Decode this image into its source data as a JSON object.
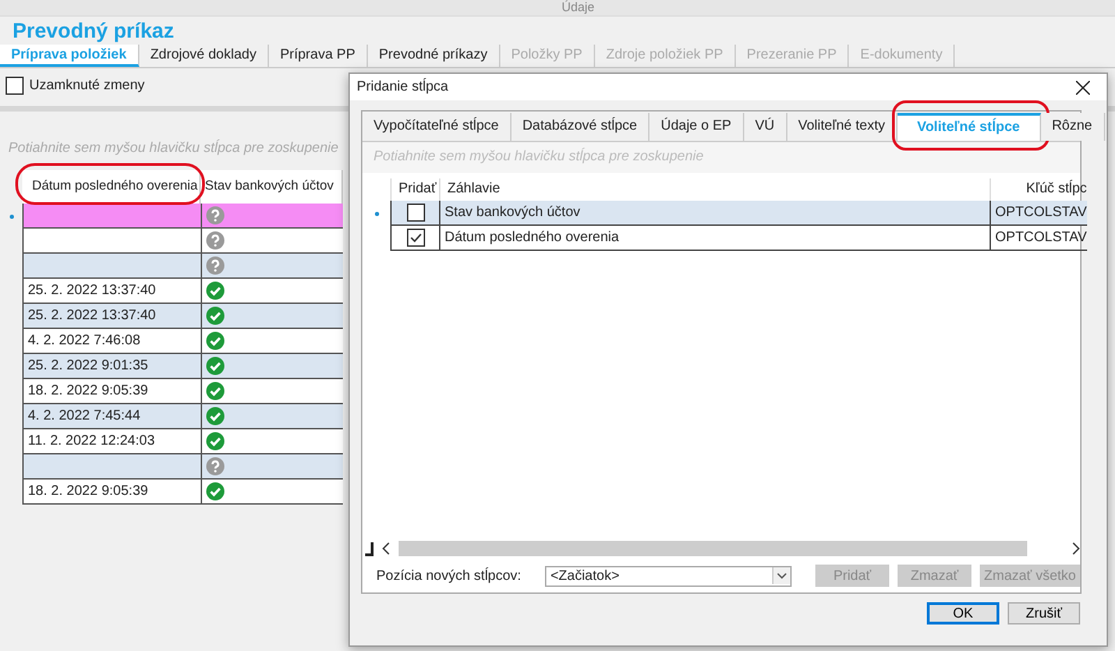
{
  "top_strip": {
    "label": "Údaje"
  },
  "title": "Prevodný príkaz",
  "tabs": [
    {
      "label": "Príprava položiek",
      "selected": true,
      "disabled": false
    },
    {
      "label": "Zdrojové doklady",
      "selected": false,
      "disabled": false
    },
    {
      "label": "Príprava PP",
      "selected": false,
      "disabled": false
    },
    {
      "label": "Prevodné príkazy",
      "selected": false,
      "disabled": false
    },
    {
      "label": "Položky PP",
      "selected": false,
      "disabled": true
    },
    {
      "label": "Zdroje položiek PP",
      "selected": false,
      "disabled": true
    },
    {
      "label": "Prezeranie PP",
      "selected": false,
      "disabled": true
    },
    {
      "label": "E-dokumenty",
      "selected": false,
      "disabled": true
    }
  ],
  "locked_changes": {
    "label": "Uzamknuté zmeny",
    "checked": false
  },
  "group_hint": "Potiahnite sem myšou hlavičku stĺpca pre zoskupenie",
  "grid": {
    "columns": [
      {
        "label": "Dátum posledného overenia",
        "highlighted": true
      },
      {
        "label": "Stav bankových účtov",
        "highlighted": false
      }
    ],
    "rows": [
      {
        "date": "",
        "kind": "unknown",
        "selected": true
      },
      {
        "date": "",
        "kind": "unknown",
        "selected": false
      },
      {
        "date": "",
        "kind": "unknown",
        "selected": false
      },
      {
        "date": "25. 2. 2022 13:37:40",
        "kind": "verified",
        "selected": false
      },
      {
        "date": "25. 2. 2022 13:37:40",
        "kind": "verified",
        "selected": false
      },
      {
        "date": "4. 2. 2022 7:46:08",
        "kind": "verified",
        "selected": false
      },
      {
        "date": "25. 2. 2022 9:01:35",
        "kind": "verified",
        "selected": false
      },
      {
        "date": "18. 2. 2022 9:05:39",
        "kind": "verified",
        "selected": false
      },
      {
        "date": "4. 2. 2022 7:45:44",
        "kind": "verified",
        "selected": false
      },
      {
        "date": "11. 2. 2022 12:24:03",
        "kind": "verified",
        "selected": false
      },
      {
        "date": "",
        "kind": "unknown",
        "selected": false
      },
      {
        "date": "18. 2. 2022 9:05:39",
        "kind": "verified",
        "selected": false
      }
    ]
  },
  "dialog": {
    "title": "Pridanie stĺpca",
    "tabs": [
      {
        "label": "Vypočítateľné stĺpce",
        "selected": false,
        "highlighted": false
      },
      {
        "label": "Databázové stĺpce",
        "selected": false,
        "highlighted": false
      },
      {
        "label": "Údaje o EP",
        "selected": false,
        "highlighted": false
      },
      {
        "label": "VÚ",
        "selected": false,
        "highlighted": false
      },
      {
        "label": "Voliteľné texty",
        "selected": false,
        "highlighted": false
      },
      {
        "label": "Voliteľné stĺpce",
        "selected": true,
        "highlighted": true
      },
      {
        "label": "Rôzne",
        "selected": false,
        "highlighted": false
      }
    ],
    "group_hint": "Potiahnite sem myšou hlavičku stĺpca pre zoskupenie",
    "columns": [
      "Pridať",
      "Záhlavie",
      "Kľúč stĺpc"
    ],
    "rows": [
      {
        "add": false,
        "header": "Stav bankových účtov",
        "key": "OPTCOLSTAV",
        "selected": true
      },
      {
        "add": true,
        "header": "Dátum posledného overenia",
        "key": "OPTCOLSTAV",
        "selected": false
      }
    ],
    "position": {
      "label": "Pozícia nových stĺpcov:",
      "value": "<Začiatok>"
    },
    "action_buttons": [
      {
        "label": "Pridať",
        "disabled": true
      },
      {
        "label": "Zmazať",
        "disabled": true
      },
      {
        "label": "Zmazať všetko",
        "disabled": true
      }
    ],
    "buttons": [
      {
        "label": "OK",
        "default": true
      },
      {
        "label": "Zrušiť",
        "default": false
      }
    ]
  }
}
